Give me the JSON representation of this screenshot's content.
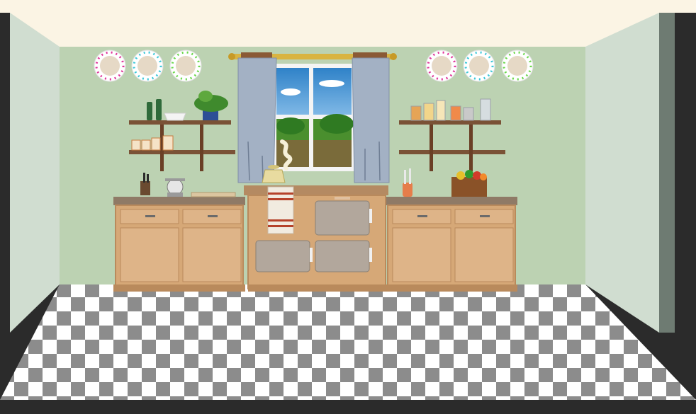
{
  "scene": {
    "name": "kitchen-room",
    "colors": {
      "frame": "#2b2b2b",
      "ceiling": "#fbf4e4",
      "back_wall": "#bcd2b2",
      "side_wall": "#d0ddd0",
      "cabinet": "#d6a877",
      "cabinet_dark": "#b98a5c",
      "countertop": "#8f7a66",
      "floor_light": "#ffffff",
      "floor_dark": "#8c8c8c",
      "curtain": "#a3b1c4",
      "curtain_rod": "#d9b441",
      "shelf": "#7a5236",
      "stove_door": "#b2a79c"
    },
    "icons": [
      "plate-icon",
      "window-icon",
      "curtain-icon",
      "wall-shelf-icon",
      "bottle-icon",
      "bowl-icon",
      "potted-plant-icon",
      "canister-icon",
      "jar-icon",
      "knife-block-icon",
      "kitchen-scale-icon",
      "cutting-board-icon",
      "kettle-icon",
      "steam-icon",
      "tea-towel-icon",
      "range-cooker-icon",
      "oven-door-icon",
      "utensil-holder-icon",
      "fruit-basket-icon",
      "cabinet-icon",
      "drawer-icon",
      "checkered-floor-icon"
    ]
  }
}
